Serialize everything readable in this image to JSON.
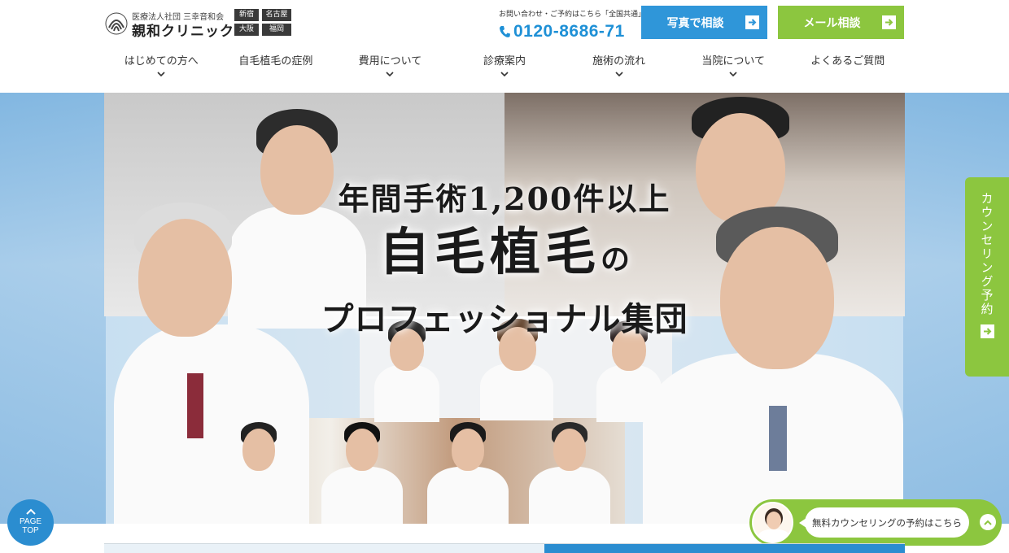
{
  "header": {
    "logo_sub": "医療法人社団 三幸音和会",
    "logo_name": "親和クリニック",
    "locations": [
      "新宿",
      "名古屋",
      "大阪",
      "福岡"
    ],
    "contact_label": "お問い合わせ・ご予約はこちら「全国共通」",
    "phone": "0120-8686-71",
    "photo_button": "写真で相談",
    "mail_button": "メール相談"
  },
  "nav": {
    "items": [
      {
        "label": "はじめての方へ",
        "has_dropdown": true
      },
      {
        "label": "自毛植毛の症例",
        "has_dropdown": false
      },
      {
        "label": "費用について",
        "has_dropdown": true
      },
      {
        "label": "診療案内",
        "has_dropdown": true
      },
      {
        "label": "施術の流れ",
        "has_dropdown": true
      },
      {
        "label": "当院について",
        "has_dropdown": true
      },
      {
        "label": "よくあるご質問",
        "has_dropdown": false
      }
    ]
  },
  "hero": {
    "line1": "年間手術1,200件以上",
    "line2": "自毛植毛",
    "line2_suffix": "の",
    "line3": "プロフェッショナル集団"
  },
  "floating": {
    "counsel_tab": "カウンセリング予約",
    "page_top_line1": "PAGE",
    "page_top_line2": "TOP",
    "banner_text": "無料カウンセリングの予約はこちら"
  },
  "colors": {
    "blue": "#2f96d9",
    "green": "#8cc63f",
    "phone": "#1e90d6"
  },
  "icons": [
    "logo-mark-icon",
    "phone-icon",
    "arrow-right-icon",
    "chevron-down-icon",
    "chevron-up-icon"
  ]
}
